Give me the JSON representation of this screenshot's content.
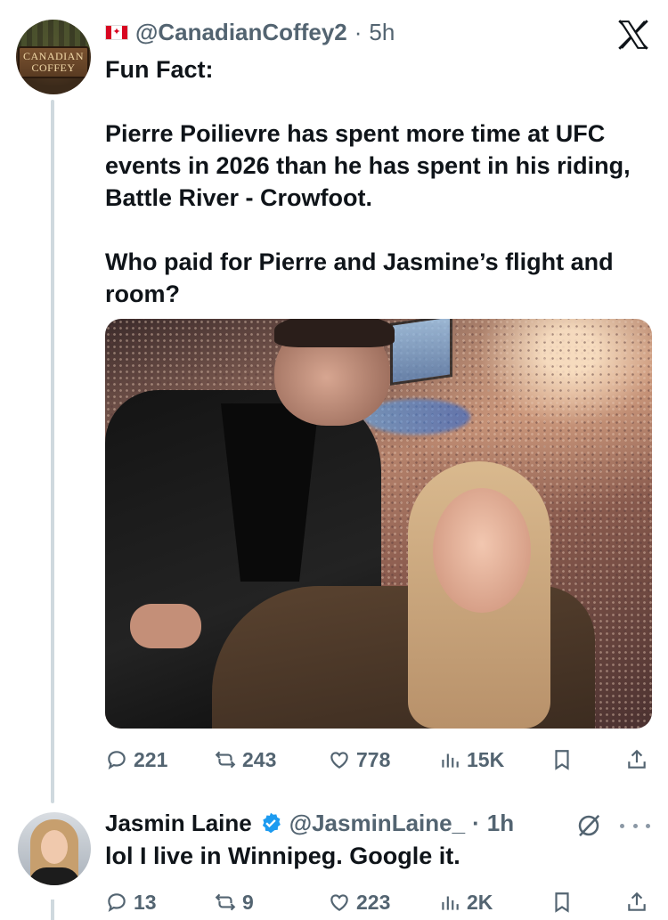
{
  "tweet": {
    "handle": "@CanadianCoffey2",
    "separator": "·",
    "time": "5h",
    "avatar_text_line1": "CANADIAN",
    "avatar_text_line2": "COFFEY",
    "text_line1": "Fun Fact:",
    "text_line2": "Pierre Poilievre has spent more time at UFC events in 2026 than he has spent in his riding, Battle River - Crowfoot.",
    "text_line3": "Who paid for Pierre and Jasmine’s flight and room?",
    "stats": {
      "replies": "221",
      "reposts": "243",
      "likes": "778",
      "views": "15K"
    }
  },
  "reply": {
    "name": "Jasmin Laine",
    "handle": "@JasminLaine_",
    "separator": "·",
    "time": "1h",
    "text": "lol I live in Winnipeg. Google it.",
    "stats": {
      "replies": "13",
      "reposts": "9",
      "likes": "223",
      "views": "2K"
    }
  },
  "colors": {
    "text": "#0f1419",
    "muted": "#536471",
    "verified": "#1d9bf0",
    "thread_line": "#cfd9de"
  },
  "icons": [
    "flag-canada-icon",
    "x-logo-icon",
    "reply-icon",
    "repost-icon",
    "like-icon",
    "views-icon",
    "bookmark-icon",
    "share-icon",
    "verified-icon",
    "grok-icon",
    "more-icon"
  ]
}
